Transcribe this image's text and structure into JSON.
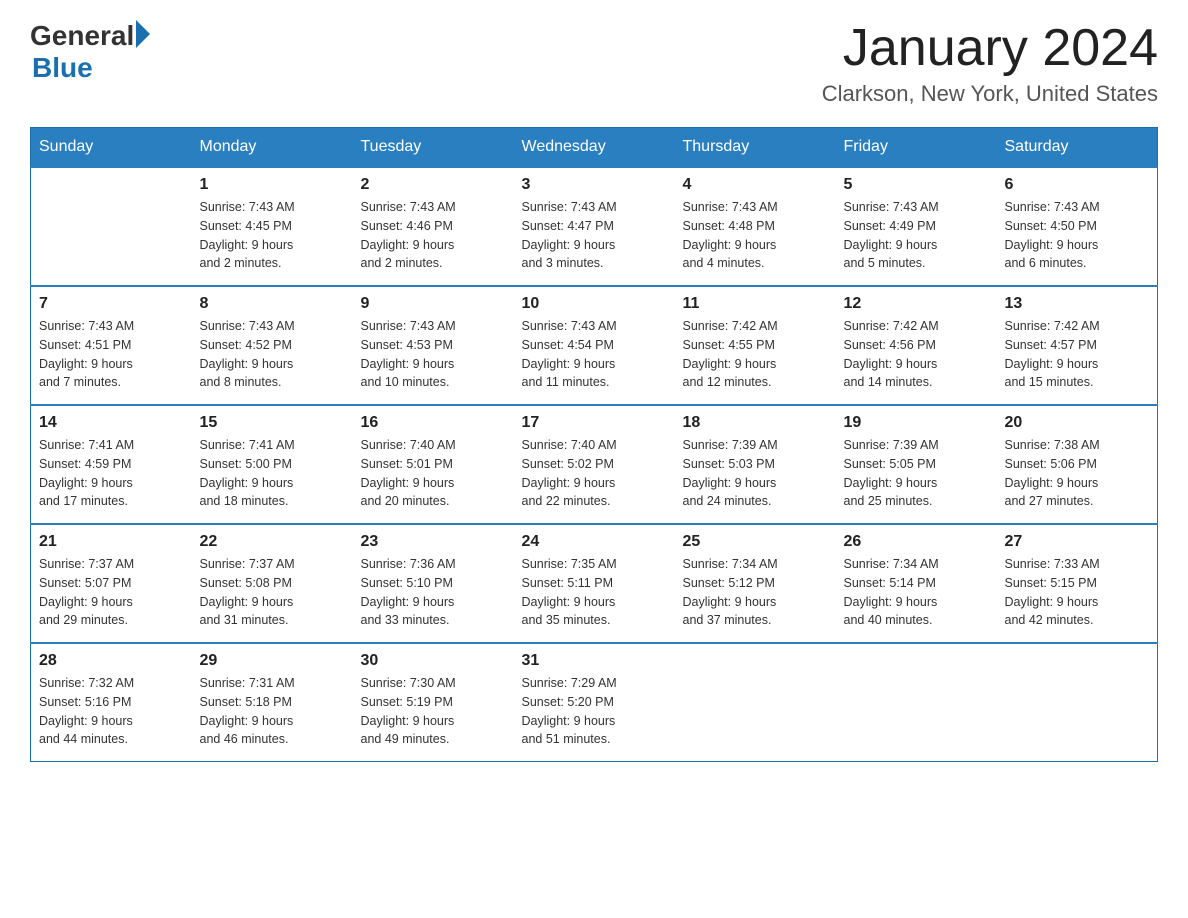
{
  "header": {
    "logo": {
      "general": "General",
      "blue": "Blue",
      "arrow": "►"
    },
    "title": "January 2024",
    "location": "Clarkson, New York, United States"
  },
  "calendar": {
    "days_of_week": [
      "Sunday",
      "Monday",
      "Tuesday",
      "Wednesday",
      "Thursday",
      "Friday",
      "Saturday"
    ],
    "weeks": [
      [
        {
          "day": "",
          "details": ""
        },
        {
          "day": "1",
          "details": "Sunrise: 7:43 AM\nSunset: 4:45 PM\nDaylight: 9 hours\nand 2 minutes."
        },
        {
          "day": "2",
          "details": "Sunrise: 7:43 AM\nSunset: 4:46 PM\nDaylight: 9 hours\nand 2 minutes."
        },
        {
          "day": "3",
          "details": "Sunrise: 7:43 AM\nSunset: 4:47 PM\nDaylight: 9 hours\nand 3 minutes."
        },
        {
          "day": "4",
          "details": "Sunrise: 7:43 AM\nSunset: 4:48 PM\nDaylight: 9 hours\nand 4 minutes."
        },
        {
          "day": "5",
          "details": "Sunrise: 7:43 AM\nSunset: 4:49 PM\nDaylight: 9 hours\nand 5 minutes."
        },
        {
          "day": "6",
          "details": "Sunrise: 7:43 AM\nSunset: 4:50 PM\nDaylight: 9 hours\nand 6 minutes."
        }
      ],
      [
        {
          "day": "7",
          "details": "Sunrise: 7:43 AM\nSunset: 4:51 PM\nDaylight: 9 hours\nand 7 minutes."
        },
        {
          "day": "8",
          "details": "Sunrise: 7:43 AM\nSunset: 4:52 PM\nDaylight: 9 hours\nand 8 minutes."
        },
        {
          "day": "9",
          "details": "Sunrise: 7:43 AM\nSunset: 4:53 PM\nDaylight: 9 hours\nand 10 minutes."
        },
        {
          "day": "10",
          "details": "Sunrise: 7:43 AM\nSunset: 4:54 PM\nDaylight: 9 hours\nand 11 minutes."
        },
        {
          "day": "11",
          "details": "Sunrise: 7:42 AM\nSunset: 4:55 PM\nDaylight: 9 hours\nand 12 minutes."
        },
        {
          "day": "12",
          "details": "Sunrise: 7:42 AM\nSunset: 4:56 PM\nDaylight: 9 hours\nand 14 minutes."
        },
        {
          "day": "13",
          "details": "Sunrise: 7:42 AM\nSunset: 4:57 PM\nDaylight: 9 hours\nand 15 minutes."
        }
      ],
      [
        {
          "day": "14",
          "details": "Sunrise: 7:41 AM\nSunset: 4:59 PM\nDaylight: 9 hours\nand 17 minutes."
        },
        {
          "day": "15",
          "details": "Sunrise: 7:41 AM\nSunset: 5:00 PM\nDaylight: 9 hours\nand 18 minutes."
        },
        {
          "day": "16",
          "details": "Sunrise: 7:40 AM\nSunset: 5:01 PM\nDaylight: 9 hours\nand 20 minutes."
        },
        {
          "day": "17",
          "details": "Sunrise: 7:40 AM\nSunset: 5:02 PM\nDaylight: 9 hours\nand 22 minutes."
        },
        {
          "day": "18",
          "details": "Sunrise: 7:39 AM\nSunset: 5:03 PM\nDaylight: 9 hours\nand 24 minutes."
        },
        {
          "day": "19",
          "details": "Sunrise: 7:39 AM\nSunset: 5:05 PM\nDaylight: 9 hours\nand 25 minutes."
        },
        {
          "day": "20",
          "details": "Sunrise: 7:38 AM\nSunset: 5:06 PM\nDaylight: 9 hours\nand 27 minutes."
        }
      ],
      [
        {
          "day": "21",
          "details": "Sunrise: 7:37 AM\nSunset: 5:07 PM\nDaylight: 9 hours\nand 29 minutes."
        },
        {
          "day": "22",
          "details": "Sunrise: 7:37 AM\nSunset: 5:08 PM\nDaylight: 9 hours\nand 31 minutes."
        },
        {
          "day": "23",
          "details": "Sunrise: 7:36 AM\nSunset: 5:10 PM\nDaylight: 9 hours\nand 33 minutes."
        },
        {
          "day": "24",
          "details": "Sunrise: 7:35 AM\nSunset: 5:11 PM\nDaylight: 9 hours\nand 35 minutes."
        },
        {
          "day": "25",
          "details": "Sunrise: 7:34 AM\nSunset: 5:12 PM\nDaylight: 9 hours\nand 37 minutes."
        },
        {
          "day": "26",
          "details": "Sunrise: 7:34 AM\nSunset: 5:14 PM\nDaylight: 9 hours\nand 40 minutes."
        },
        {
          "day": "27",
          "details": "Sunrise: 7:33 AM\nSunset: 5:15 PM\nDaylight: 9 hours\nand 42 minutes."
        }
      ],
      [
        {
          "day": "28",
          "details": "Sunrise: 7:32 AM\nSunset: 5:16 PM\nDaylight: 9 hours\nand 44 minutes."
        },
        {
          "day": "29",
          "details": "Sunrise: 7:31 AM\nSunset: 5:18 PM\nDaylight: 9 hours\nand 46 minutes."
        },
        {
          "day": "30",
          "details": "Sunrise: 7:30 AM\nSunset: 5:19 PM\nDaylight: 9 hours\nand 49 minutes."
        },
        {
          "day": "31",
          "details": "Sunrise: 7:29 AM\nSunset: 5:20 PM\nDaylight: 9 hours\nand 51 minutes."
        },
        {
          "day": "",
          "details": ""
        },
        {
          "day": "",
          "details": ""
        },
        {
          "day": "",
          "details": ""
        }
      ]
    ]
  }
}
